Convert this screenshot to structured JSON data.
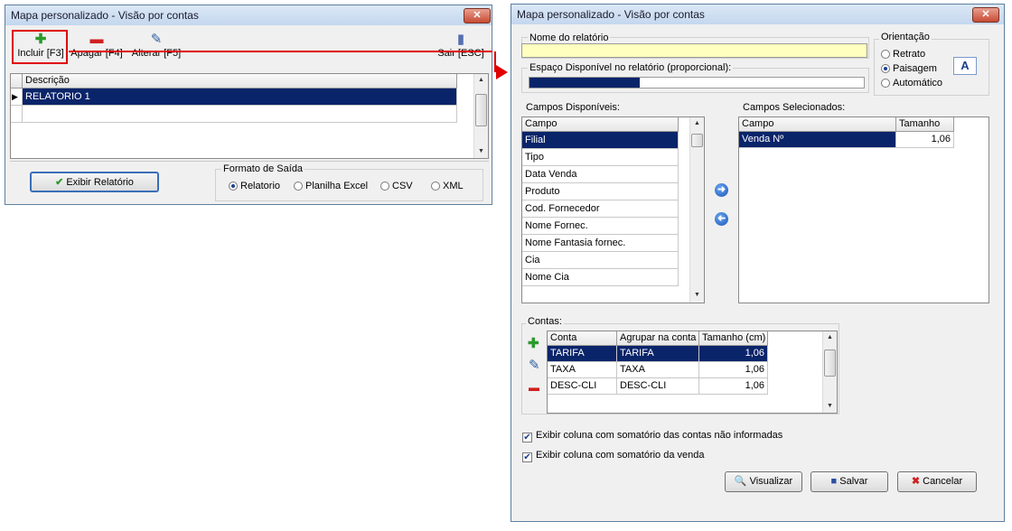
{
  "left_window": {
    "title": "Mapa personalizado - Visão por contas",
    "close": "✕",
    "toolbar": {
      "incluir": "Incluir [F3]",
      "apagar": "Apagar [F4]",
      "alterar": "Alterar [F5]",
      "sair": "Sair [ESC]"
    },
    "grid": {
      "header": "Descrição",
      "rows": [
        "RELATORIO 1"
      ]
    },
    "exibir_button": "Exibir Relatório",
    "formato": {
      "label": "Formato de Saída",
      "options": [
        "Relatorio",
        "Planilha Excel",
        "CSV",
        "XML"
      ],
      "selected": "Relatorio"
    }
  },
  "right_window": {
    "title": "Mapa personalizado - Visão por contas",
    "close": "✕",
    "nome_label": "Nome do relatório",
    "nome_value": "",
    "espaco_label": "Espaço Disponível no relatório (proporcional):",
    "espaco_fill_fraction": 0.33,
    "orientacao": {
      "label": "Orientação",
      "options": [
        "Retrato",
        "Paisagem",
        "Automático"
      ],
      "selected": "Paisagem",
      "preview_glyph": "A"
    },
    "campos_disponiveis": {
      "label": "Campos Disponíveis:",
      "header": "Campo",
      "items": [
        "Filial",
        "Tipo",
        "Data Venda",
        "Produto",
        "Cod. Fornecedor",
        "Nome Fornec.",
        "Nome Fantasia fornec.",
        "Cia",
        "Nome Cia"
      ],
      "selected_index": 0
    },
    "campos_selecionados": {
      "label": "Campos Selecionados:",
      "headers": [
        "Campo",
        "Tamanho"
      ],
      "rows": [
        {
          "campo": "Venda Nº",
          "tamanho": "1,06"
        }
      ]
    },
    "contas": {
      "label": "Contas:",
      "headers": [
        "Conta",
        "Agrupar na conta",
        "Tamanho (cm)"
      ],
      "rows": [
        {
          "conta": "TARIFA",
          "agrupar": "TARIFA",
          "tamanho": "1,06"
        },
        {
          "conta": "TAXA",
          "agrupar": "TAXA",
          "tamanho": "1,06"
        },
        {
          "conta": "DESC-CLI",
          "agrupar": "DESC-CLI",
          "tamanho": "1,06"
        }
      ]
    },
    "checks": [
      {
        "label": "Exibir coluna com somatório das contas não informadas",
        "checked": true
      },
      {
        "label": "Exibir coluna com somatório da venda",
        "checked": true
      }
    ],
    "buttons": {
      "visualizar": "Visualizar",
      "salvar": "Salvar",
      "cancelar": "Cancelar"
    }
  },
  "colors": {
    "selection": "#0a246a",
    "highlight_box": "#e00000",
    "name_field_bg": "#ffffc0",
    "progress": "#0a246a"
  }
}
